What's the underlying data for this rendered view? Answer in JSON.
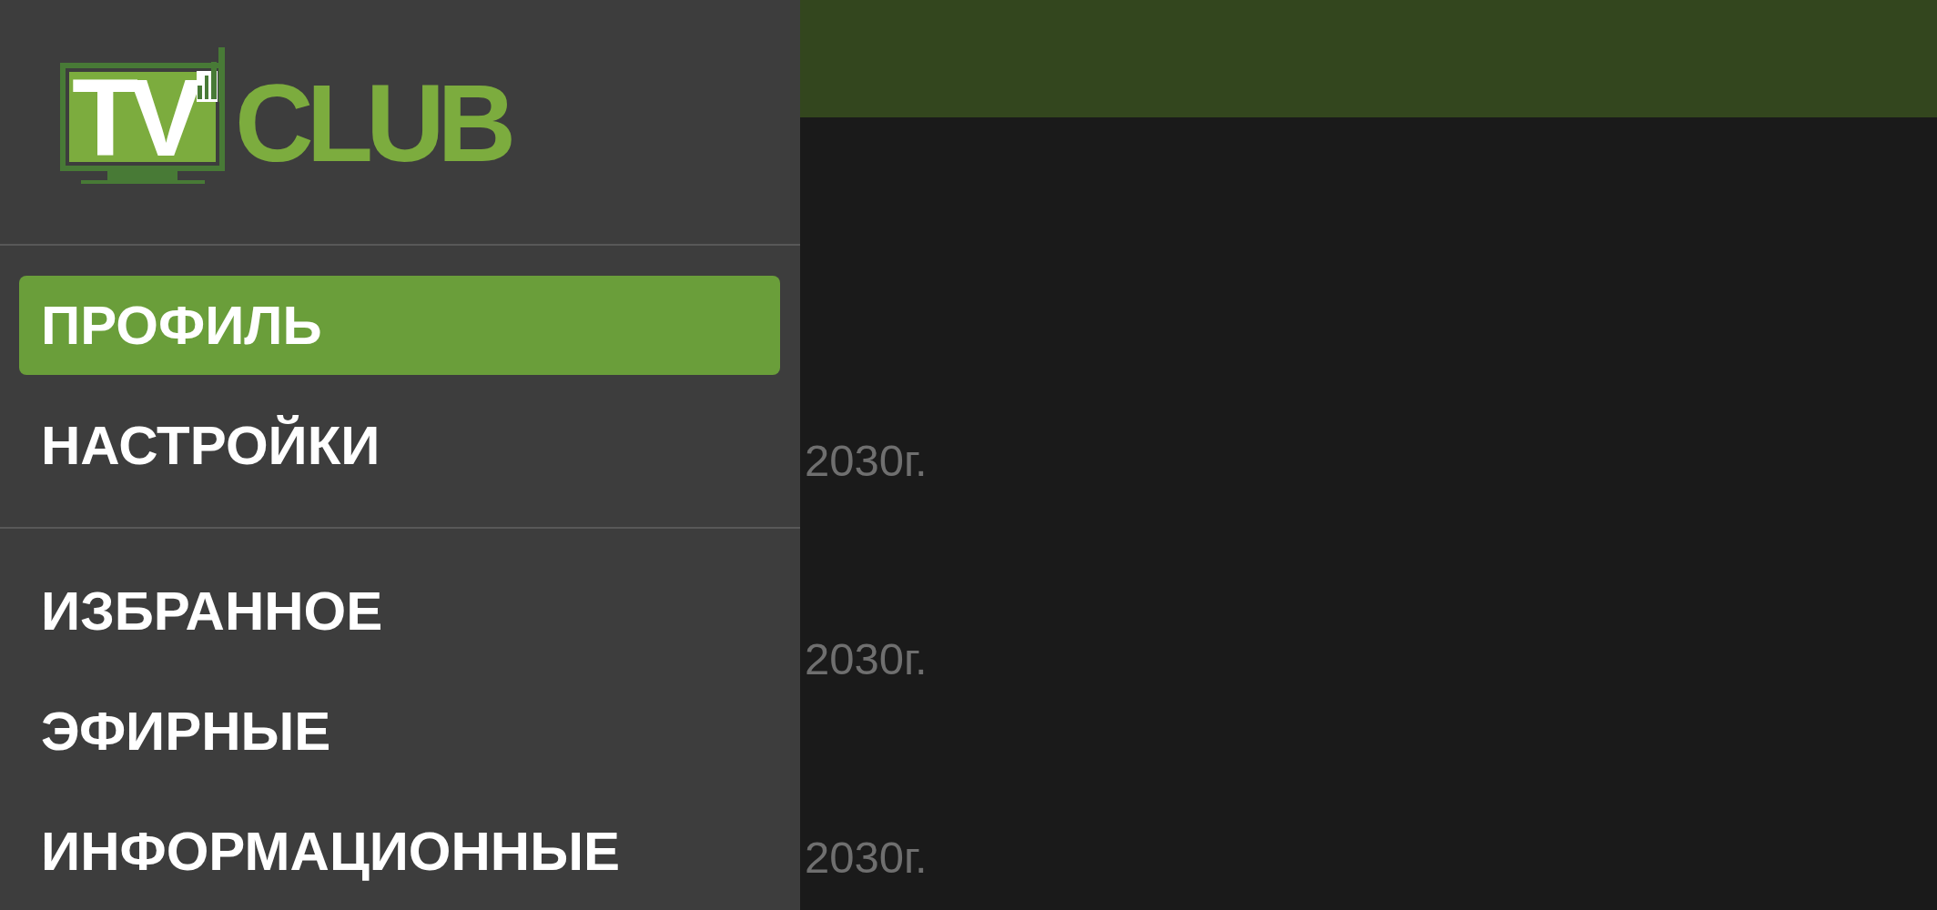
{
  "drawer": {
    "logo": {
      "mark_text": "TV",
      "wordmark": "CLUB"
    },
    "sections": [
      {
        "items": [
          {
            "label": "ПРОФИЛЬ",
            "selected": true
          },
          {
            "label": "НАСТРОЙКИ",
            "selected": false
          }
        ]
      },
      {
        "items": [
          {
            "label": "ИЗБРАННОЕ",
            "selected": false
          },
          {
            "label": "ЭФИРНЫЕ",
            "selected": false
          },
          {
            "label": "ИНФОРМАЦИОННЫЕ",
            "selected": false
          }
        ]
      }
    ]
  },
  "content": {
    "rows": [
      {
        "text": "2030г."
      },
      {
        "text": "2030г."
      },
      {
        "text": "2030г."
      }
    ]
  }
}
